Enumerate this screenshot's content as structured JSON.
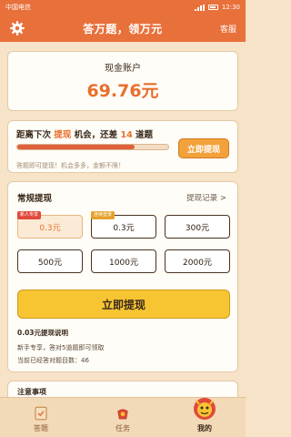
{
  "status_bar": {
    "carrier": "中国电信",
    "time": "12:30"
  },
  "header": {
    "title": "答万题，领万元",
    "service": "客服"
  },
  "balance": {
    "label": "现金账户",
    "value": "69.76元"
  },
  "withdraw_progress": {
    "prefix": "距离下次",
    "highlight_word": "提现",
    "middle": "机会，还差",
    "remaining": "14",
    "suffix": "道题",
    "progress": 0.78,
    "button_label": "立即提现",
    "hint": "答题即可提现！机会多多，金额不限！"
  },
  "regular_withdraw": {
    "title": "常规提现",
    "record_link": "提现记录 >",
    "options": [
      {
        "amount": "0.3元",
        "tag": "新人专享",
        "tag_color": "#e04a3a",
        "selected": true
      },
      {
        "amount": "0.3元",
        "tag": "连续登录",
        "tag_color": "#e6a02a",
        "selected": false
      },
      {
        "amount": "300元",
        "tag": "",
        "selected": false
      },
      {
        "amount": "500元",
        "tag": "",
        "selected": false
      },
      {
        "amount": "1000元",
        "tag": "",
        "selected": false
      },
      {
        "amount": "2000元",
        "tag": "",
        "selected": false
      }
    ],
    "button_label": "立即提现",
    "note_title": "0.03元提现说明",
    "note_line1": "新手专享，答对5道题即可领取",
    "note_line2": "当前已经答对题目数：46"
  },
  "notice": {
    "title": "注意事项"
  },
  "tabs": [
    {
      "label": "答题",
      "icon": "answer-icon",
      "active": false
    },
    {
      "label": "任务",
      "icon": "task-icon",
      "active": false
    },
    {
      "label": "我的",
      "icon": "lion-mascot-icon",
      "active": true
    }
  ],
  "colors": {
    "accent": "#e8703a",
    "highlight": "#e8702c",
    "button_yellow": "#f7c531",
    "background": "#f6e3c8"
  }
}
